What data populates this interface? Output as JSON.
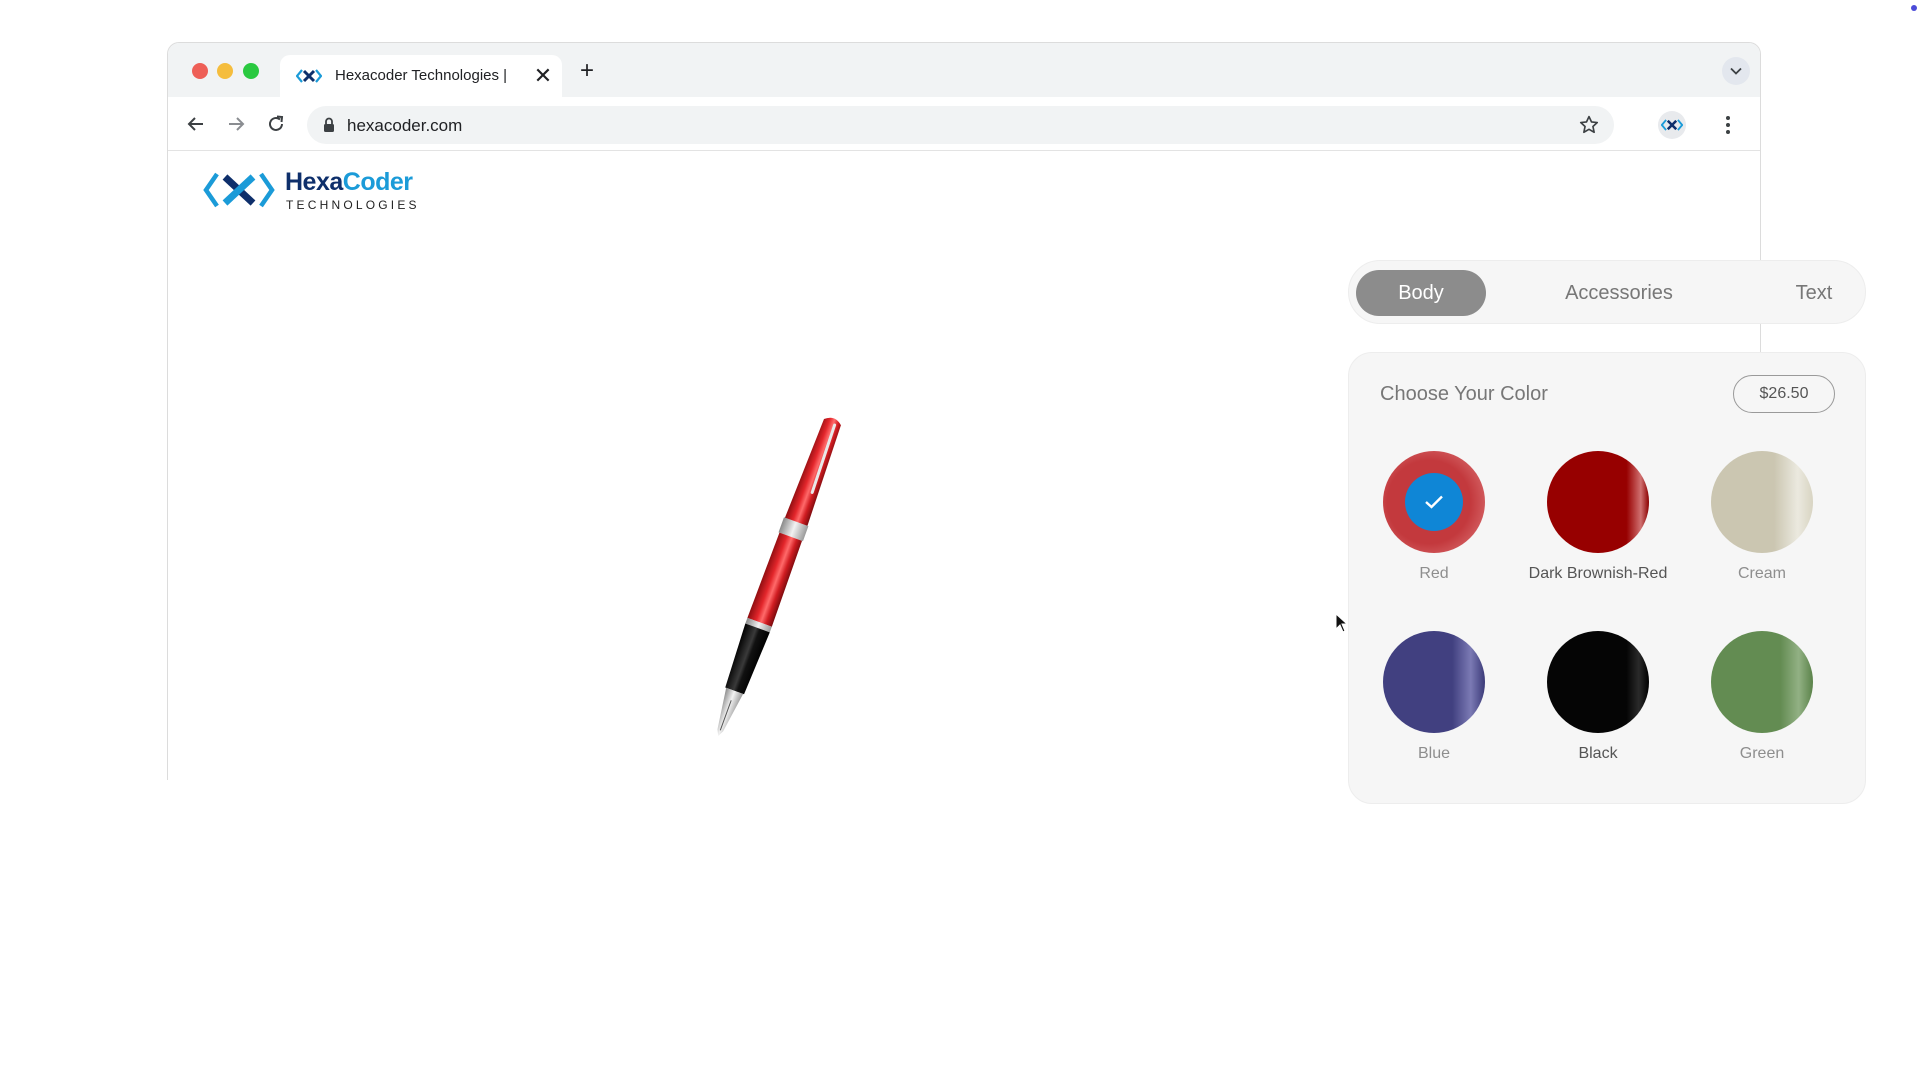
{
  "browser": {
    "tab_title": "Hexacoder Technologies |",
    "tab_close_glyph": "✕",
    "new_tab_glyph": "+",
    "url": "hexacoder.com"
  },
  "logo": {
    "word_part1": "Hexa",
    "word_part2": "Coder",
    "subtitle": "TECHNOLOGIES"
  },
  "customizer": {
    "tabs": [
      {
        "label": "Body",
        "active": true
      },
      {
        "label": "Accessories",
        "active": false
      },
      {
        "label": "Text",
        "active": false
      }
    ],
    "panel_title": "Choose Your Color",
    "price": "$26.50",
    "selected_color": "Red",
    "colors": [
      {
        "label": "Red",
        "hex": "#c3393d"
      },
      {
        "label": "Dark Brownish-Red",
        "hex": "#970000"
      },
      {
        "label": "Cream",
        "hex": "#cbc6b1"
      },
      {
        "label": "Blue",
        "hex": "#414080"
      },
      {
        "label": "Black",
        "hex": "#050505"
      },
      {
        "label": "Green",
        "hex": "#638c52"
      }
    ]
  },
  "colors": {
    "check_badge": "#0f86d6",
    "active_tab_bg": "#8c8c8c",
    "logo_dark": "#0e2f6b",
    "logo_light": "#1b9bd8"
  },
  "icons": {
    "tab_favicon": "hexacoder-logo-icon",
    "back": "arrow-left-icon",
    "forward": "arrow-right-icon",
    "reload": "reload-icon",
    "lock": "lock-icon",
    "bookmark": "star-icon",
    "extension": "hexacoder-logo-icon",
    "menu": "kebab-menu-icon",
    "tab_list": "chevron-down-icon",
    "selected": "check-icon"
  }
}
